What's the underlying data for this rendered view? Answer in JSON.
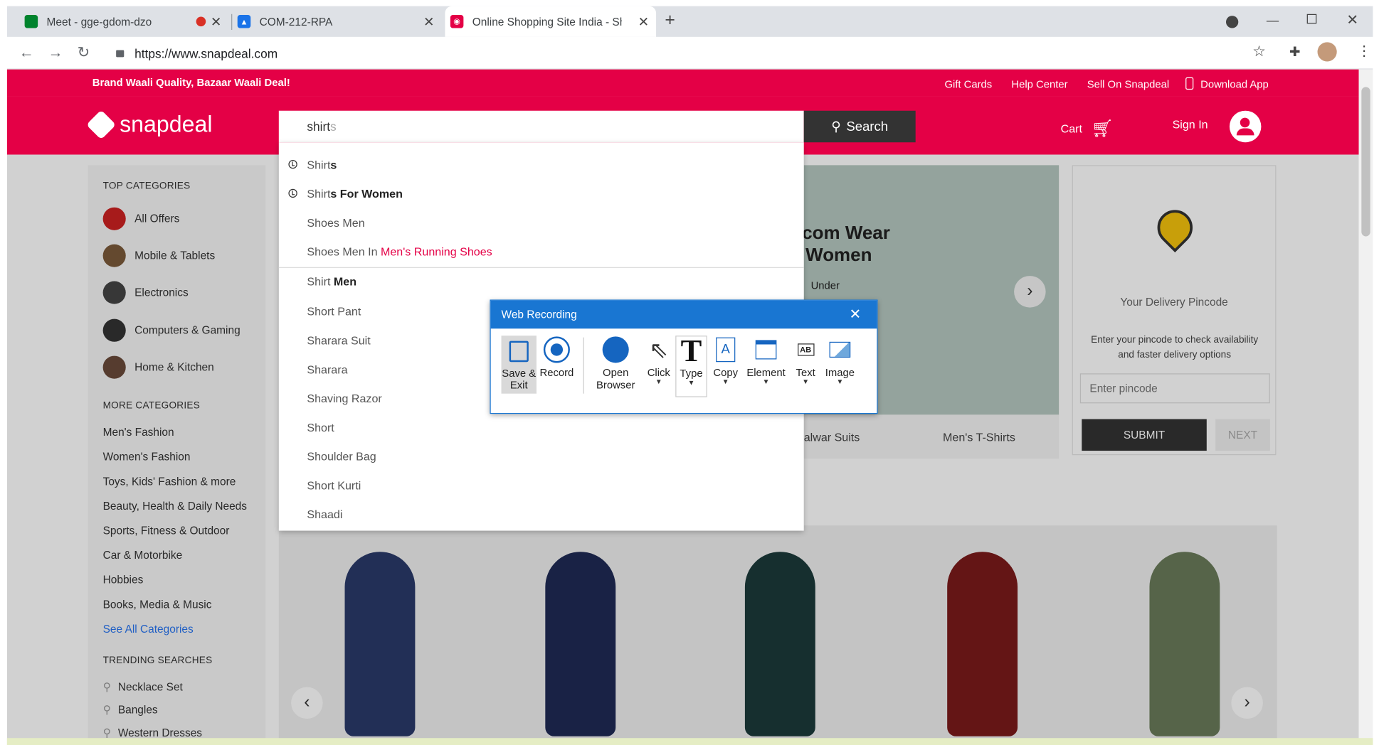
{
  "browser": {
    "tabs": [
      {
        "title": "Meet - gge-gdom-dzo",
        "icon": "google-meet-icon"
      },
      {
        "title": "COM-212-RPA",
        "icon": "classroom-icon"
      },
      {
        "title": "Online Shopping Site India - Sho",
        "icon": "snapdeal-icon"
      }
    ],
    "url": "https://www.snapdeal.com"
  },
  "topbar": {
    "tagline": "Brand Waali Quality, Bazaar Waali Deal!",
    "links": [
      "Gift Cards",
      "Help Center",
      "Sell On Snapdeal",
      "Download App"
    ]
  },
  "header": {
    "logo": "snapdeal",
    "search_value": "shirts",
    "search_typed": "shirt",
    "search_ghost": "s",
    "search_button": "Search",
    "cart": "Cart",
    "signin": "Sign In"
  },
  "suggestions": [
    {
      "pre": "Shirt",
      "bold": "s",
      "history": true
    },
    {
      "pre": "Shirt",
      "bold": "s For Women",
      "history": true
    },
    {
      "pre": "Shoes Men"
    },
    {
      "pre": "Shoes Men In ",
      "red": "Men's Running Shoes"
    },
    {
      "pre": "Shirt ",
      "bold": "Men"
    },
    {
      "pre": "Short Pant"
    },
    {
      "pre": "Sharara Suit"
    },
    {
      "pre": "Sharara"
    },
    {
      "pre": "Shaving Razor"
    },
    {
      "pre": "Short"
    },
    {
      "pre": "Shoulder Bag"
    },
    {
      "pre": "Short Kurti"
    },
    {
      "pre": "Shaadi"
    }
  ],
  "sidebar": {
    "top_title": "TOP CATEGORIES",
    "top": [
      "All Offers",
      "Mobile & Tablets",
      "Electronics",
      "Computers & Gaming",
      "Home & Kitchen"
    ],
    "more_title": "MORE CATEGORIES",
    "more": [
      "Men's Fashion",
      "Women's Fashion",
      "Toys, Kids' Fashion & more",
      "Beauty, Health & Daily Needs",
      "Sports, Fitness & Outdoor",
      "Car & Motorbike",
      "Hobbies",
      "Books, Media & Music"
    ],
    "see_all": "See All Categories",
    "trend_title": "TRENDING SEARCHES",
    "trending": [
      "Necklace Set",
      "Bangles",
      "Western Dresses"
    ]
  },
  "banner": {
    "line1": "com Wear",
    "line2": "Women",
    "under": "Under",
    "tabs": [
      "alwar Suits",
      "Men's T-Shirts"
    ]
  },
  "pincode": {
    "title": "Your Delivery Pincode",
    "desc": "Enter your pincode to check availability and faster delivery options",
    "placeholder": "Enter pincode",
    "submit": "SUBMIT",
    "next": "NEXT"
  },
  "recorder": {
    "title": "Web Recording",
    "tools": [
      "Save & Exit",
      "Record",
      "Open Browser",
      "Click",
      "Type",
      "Copy",
      "Element",
      "Text",
      "Image"
    ]
  },
  "colors": {
    "brand": "#e40046",
    "recorder": "#1976d2"
  }
}
